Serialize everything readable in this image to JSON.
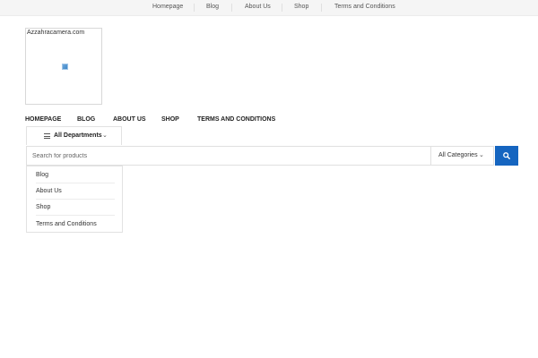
{
  "topbar": {
    "links": [
      "Homepage",
      "Blog",
      "About Us",
      "Shop",
      "Terms and Conditions"
    ]
  },
  "logo": {
    "text": "Azzahracamera.com",
    "image_icon": "broken-image-icon"
  },
  "main_nav": {
    "items": [
      "HOMEPAGE",
      "BLOG",
      "ABOUT US",
      "SHOP",
      "TERMS AND CONDITIONS"
    ]
  },
  "departments": {
    "label": "All Departments",
    "menu_icon": "hamburger-icon",
    "chevron_icon": "chevron-down-icon",
    "items": [
      "Blog",
      "About Us",
      "Shop",
      "Terms and Conditions"
    ]
  },
  "search": {
    "placeholder": "Search for products",
    "value": "",
    "category_selected": "All Categories",
    "button_icon": "search-icon",
    "accent_color": "#1565c0"
  }
}
